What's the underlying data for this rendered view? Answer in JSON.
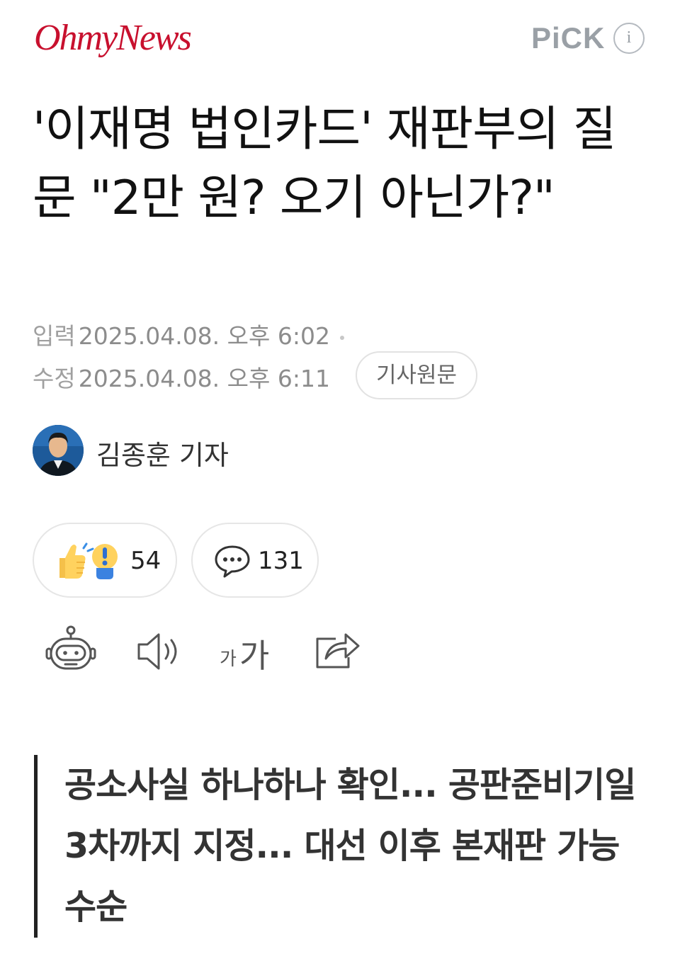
{
  "header": {
    "logo_text": "OhmyNews",
    "pick_label": "PiCK",
    "info_symbol": "i",
    "brand_color": "#c8102e"
  },
  "article": {
    "headline": "'이재명 법인카드' 재판부의 질문 \"2만 원? 오기 아닌가?\"",
    "input_label": "입력",
    "input_time": "2025.04.08. 오후 6:02",
    "edit_label": "수정",
    "edit_time": "2025.04.08. 오후 6:11",
    "original_button": "기사원문",
    "summary": "공소사실 하나하나 확인... 공판준비기일 3차까지 지정... 대선 이후 본재판 가능 수순"
  },
  "author": {
    "name": "김종훈 기자"
  },
  "reactions": {
    "reaction_count": "54",
    "comment_count": "131"
  },
  "toolbar": {
    "font_size_small": "가",
    "font_size_large": "가",
    "icons": [
      "robot-summary-icon",
      "speaker-icon",
      "font-size-icon",
      "share-icon"
    ]
  }
}
